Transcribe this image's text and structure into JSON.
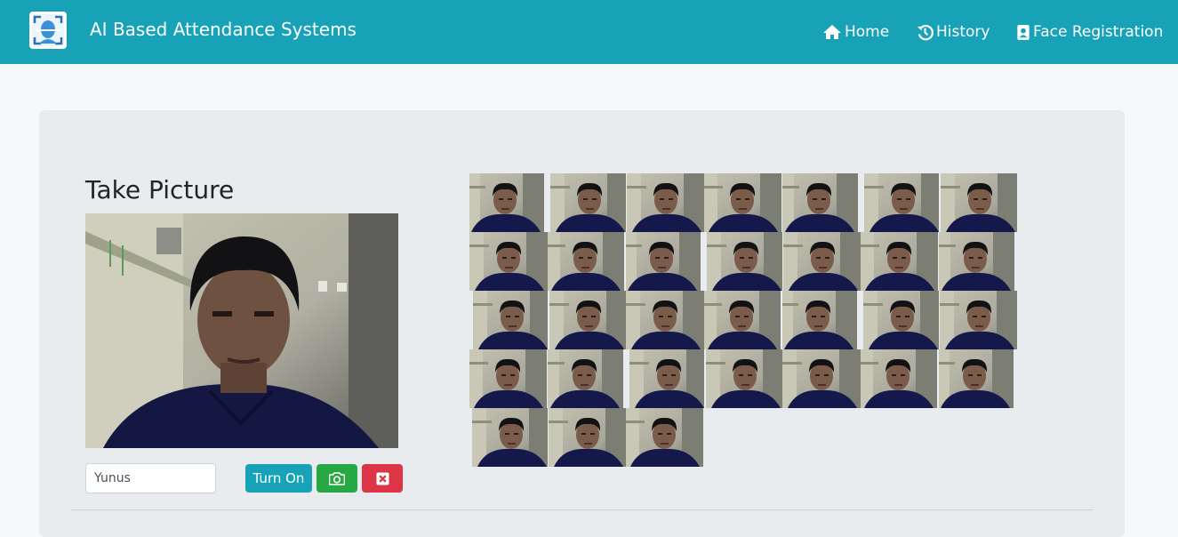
{
  "app": {
    "title": "AI Based Attendance Systems",
    "logo_icon": "face-scan-logo-icon"
  },
  "nav": {
    "items": [
      {
        "label": "Home",
        "icon": "home-icon"
      },
      {
        "label": "History",
        "icon": "history-icon"
      },
      {
        "label": "Face Registration",
        "icon": "id-badge-icon"
      }
    ]
  },
  "main": {
    "title": "Take Picture",
    "webcam_feed": "live-webcam-feed",
    "name_input": {
      "value": "Yunus"
    },
    "buttons": {
      "turn_on": "Turn On",
      "capture_icon": "camera-icon",
      "clear_icon": "close-icon"
    },
    "captured_photos_count": 31
  },
  "colors": {
    "navbar": "#17a2b8",
    "page_bg": "#f7f8fa",
    "panel_bg": "#e9ecef",
    "info": "#17a2b8",
    "success": "#28a745",
    "danger": "#dc3545"
  }
}
